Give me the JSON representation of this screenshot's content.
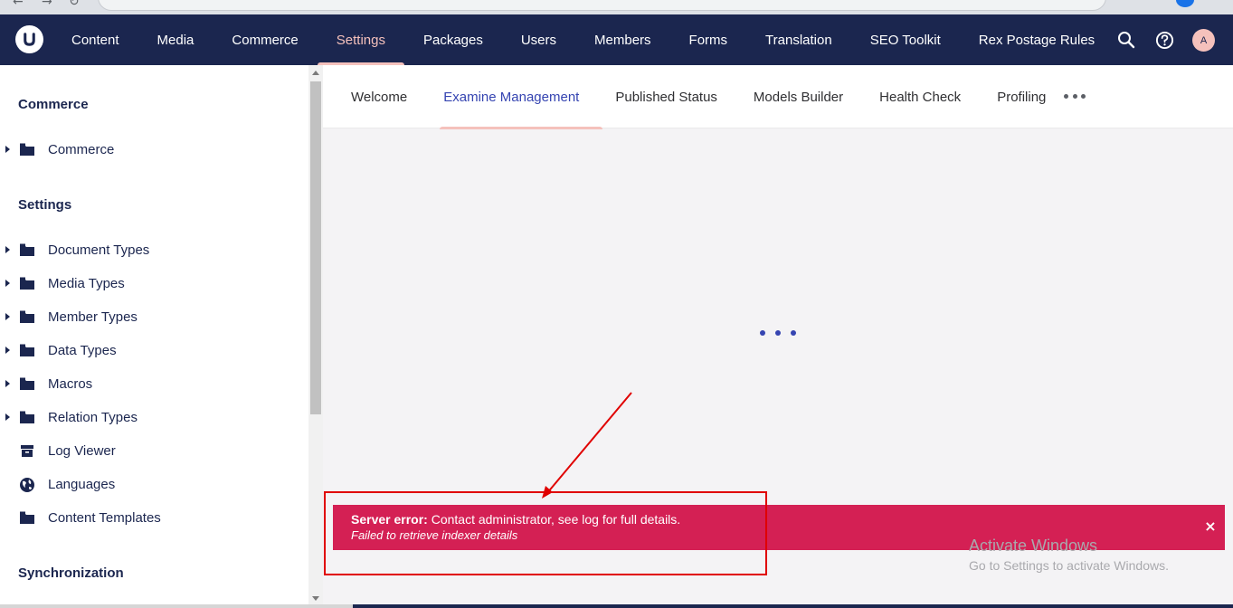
{
  "header": {
    "sections": [
      {
        "label": "Content",
        "active": false
      },
      {
        "label": "Media",
        "active": false
      },
      {
        "label": "Commerce",
        "active": false
      },
      {
        "label": "Settings",
        "active": true
      },
      {
        "label": "Packages",
        "active": false
      },
      {
        "label": "Users",
        "active": false
      },
      {
        "label": "Members",
        "active": false
      },
      {
        "label": "Forms",
        "active": false
      },
      {
        "label": "Translation",
        "active": false
      },
      {
        "label": "SEO Toolkit",
        "active": false
      },
      {
        "label": "Rex Postage Rules",
        "active": false
      }
    ],
    "tools": [
      "search-icon",
      "help-icon"
    ],
    "user_initial": "A"
  },
  "sidebar": {
    "groups": [
      {
        "title": "Commerce",
        "items": [
          {
            "label": "Commerce",
            "icon": "folder-icon",
            "expandable": true
          }
        ]
      },
      {
        "title": "Settings",
        "items": [
          {
            "label": "Document Types",
            "icon": "folder-icon",
            "expandable": true
          },
          {
            "label": "Media Types",
            "icon": "folder-icon",
            "expandable": true
          },
          {
            "label": "Member Types",
            "icon": "folder-icon",
            "expandable": true
          },
          {
            "label": "Data Types",
            "icon": "folder-icon",
            "expandable": true
          },
          {
            "label": "Macros",
            "icon": "folder-icon",
            "expandable": true
          },
          {
            "label": "Relation Types",
            "icon": "folder-icon",
            "expandable": true
          },
          {
            "label": "Log Viewer",
            "icon": "box-icon",
            "expandable": false
          },
          {
            "label": "Languages",
            "icon": "globe-icon",
            "expandable": false
          },
          {
            "label": "Content Templates",
            "icon": "folder-icon",
            "expandable": false
          }
        ]
      },
      {
        "title": "Synchronization",
        "items": []
      }
    ]
  },
  "dashboard": {
    "tabs": [
      {
        "label": "Welcome",
        "active": false
      },
      {
        "label": "Examine Management",
        "active": true
      },
      {
        "label": "Published Status",
        "active": false
      },
      {
        "label": "Models Builder",
        "active": false
      },
      {
        "label": "Health Check",
        "active": false
      },
      {
        "label": "Profiling",
        "active": false
      }
    ],
    "more_icon": "more-icon",
    "loading": true
  },
  "notification": {
    "title": "Server error:",
    "message": "Contact administrator, see log for full details.",
    "detail": "Failed to retrieve indexer details",
    "close_glyph": "×",
    "color": "#d42054"
  },
  "watermark": {
    "title": "Activate Windows",
    "subtitle": "Go to Settings to activate Windows."
  },
  "colors": {
    "header": "#1b264f",
    "accent": "#f5c1bc",
    "active_tab": "#3544b1",
    "annotation": "#e00000"
  }
}
